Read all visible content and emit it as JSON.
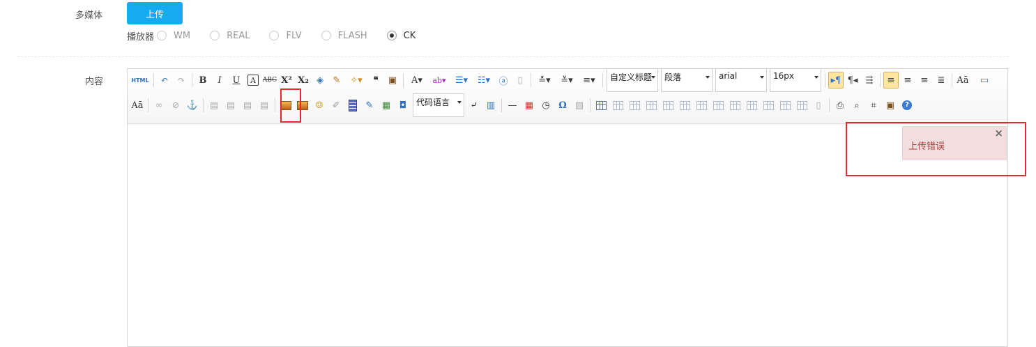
{
  "form": {
    "multimedia_label": "多媒体",
    "upload_label": "上传",
    "player_label": "播放器",
    "players": [
      {
        "label": "WM",
        "checked": false
      },
      {
        "label": "REAL",
        "checked": false
      },
      {
        "label": "FLV",
        "checked": false
      },
      {
        "label": "FLASH",
        "checked": false
      },
      {
        "label": "CK",
        "checked": true
      }
    ],
    "content_label": "内容"
  },
  "editor": {
    "html_label": "HTML",
    "custom_heading": "自定义标题",
    "paragraph": "段落",
    "font_family": "arial",
    "font_size": "16px",
    "code_language": "代码语言",
    "omega": "Ω"
  },
  "alert": {
    "message": "上传错误",
    "close": "×"
  },
  "colors": {
    "accent": "#16aaf0",
    "alert_bg": "#f2dede",
    "alert_text": "#a94442",
    "highlight": "#e02b2b"
  }
}
